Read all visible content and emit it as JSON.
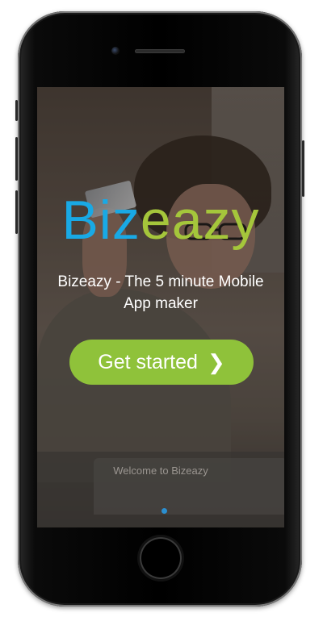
{
  "brand": {
    "part1": "Biz",
    "part2": "eazy",
    "color_primary": "#19a9e5",
    "color_secondary": "#a5c63b"
  },
  "tagline": "Bizeazy - The 5 minute Mobile App maker",
  "cta": {
    "label": "Get started",
    "icon": "chevron-right-icon",
    "chevron": "❯",
    "color": "#8fc23a"
  },
  "footer": {
    "welcome": "Welcome to Bizeazy"
  },
  "pager": {
    "current": 1,
    "total": 1,
    "color": "#2b8fd0"
  }
}
